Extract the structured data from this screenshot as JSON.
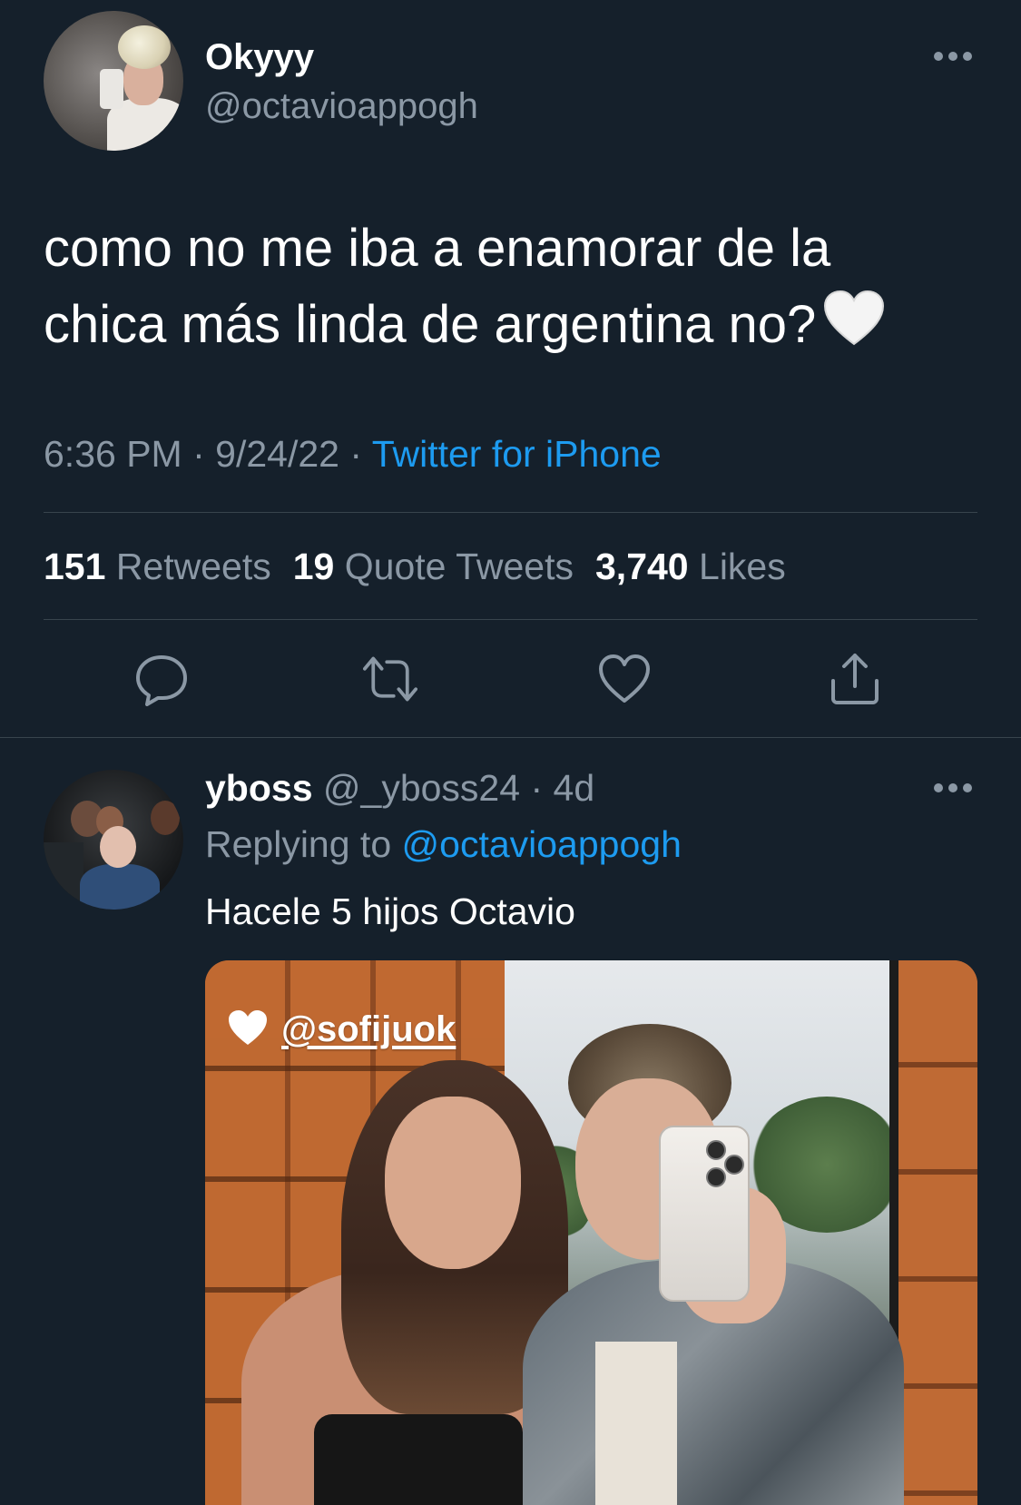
{
  "tweet": {
    "author": {
      "display_name": "Okyyy",
      "handle": "@octavioappogh",
      "avatar_icon": "profile-photo"
    },
    "text_line1": "como no me iba a enamorar de la",
    "text_line2": "chica más linda de argentina no?",
    "emoji": "white-heart",
    "time": "6:36 PM",
    "separator": "·",
    "date": "9/24/22",
    "source": "Twitter for iPhone",
    "stats": {
      "retweets_count": "151",
      "retweets_label": "Retweets",
      "quotes_count": "19",
      "quotes_label": "Quote Tweets",
      "likes_count": "3,740",
      "likes_label": "Likes"
    },
    "actions": [
      "reply-icon",
      "retweet-icon",
      "like-icon",
      "share-icon"
    ]
  },
  "reply": {
    "display_name": "yboss",
    "handle": "@_yboss24",
    "separator": "·",
    "age": "4d",
    "replying_prefix": "Replying to",
    "replying_to": "@octavioappogh",
    "text": "Hacele 5 hijos Octavio",
    "media": {
      "caption_tag": "@sofijuok",
      "caption_icon": "white-heart"
    }
  },
  "colors": {
    "background": "#15202b",
    "primary_text": "#ffffff",
    "secondary_text": "#8b98a5",
    "accent": "#1d9bf0",
    "divider": "#38444d"
  }
}
